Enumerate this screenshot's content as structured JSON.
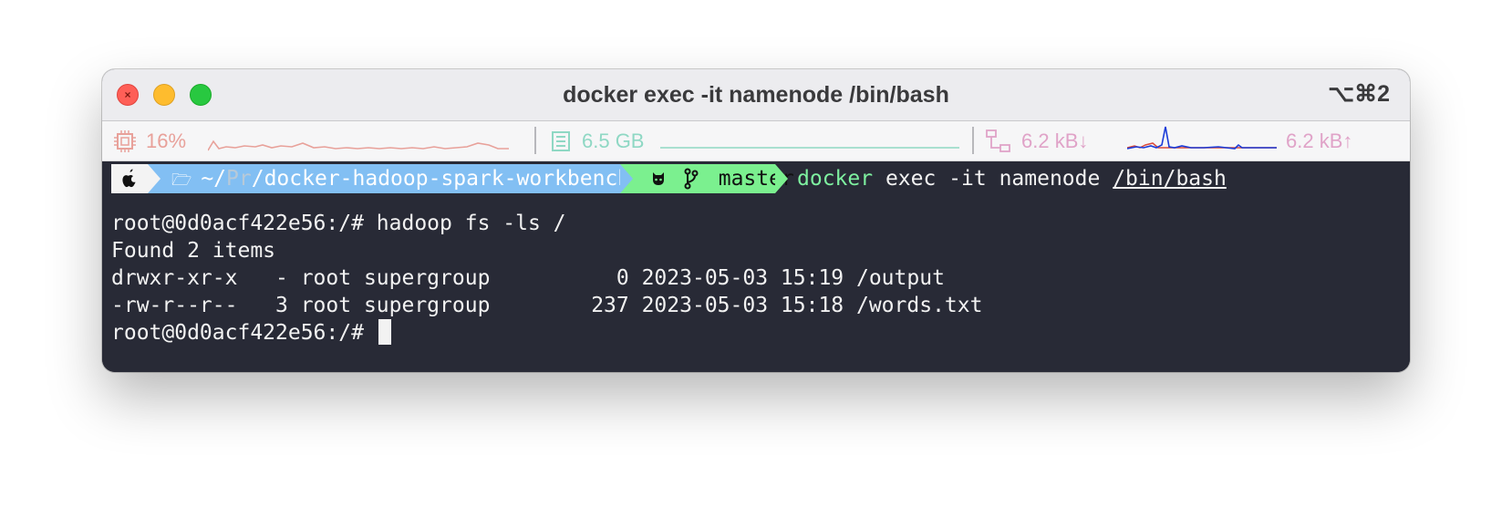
{
  "window": {
    "title": "docker exec -it namenode /bin/bash",
    "shortcut": "⌥⌘2"
  },
  "statusbar": {
    "cpu": {
      "icon": "cpu-icon",
      "value": "16%",
      "color": "#e8a19a"
    },
    "memory": {
      "icon": "memory-icon",
      "value": "6.5 GB",
      "color": "#8fd8c4"
    },
    "network": {
      "icon": "network-icon",
      "down": "6.2 kB↓",
      "up": "6.2 kB↑",
      "color": "#e0a3c8"
    }
  },
  "prompt": {
    "apple": "",
    "dir_home": "~/",
    "dir_abbrev": "Pr",
    "dir_rest": "/docker-hadoop-spark-workbench",
    "branch": "master",
    "cmd_program": "docker",
    "cmd_args": " exec -it namenode ",
    "cmd_path": "/bin/bash"
  },
  "terminal": {
    "lines": [
      "root@0d0acf422e56:/# hadoop fs -ls /",
      "Found 2 items",
      "drwxr-xr-x   - root supergroup          0 2023-05-03 15:19 /output",
      "-rw-r--r--   3 root supergroup        237 2023-05-03 15:18 /words.txt"
    ],
    "current_prompt": "root@0d0acf422e56:/# "
  },
  "colors": {
    "terminal_bg": "#282a36",
    "prompt_dir_bg": "#82bff3",
    "prompt_git_bg": "#7bf08f"
  }
}
